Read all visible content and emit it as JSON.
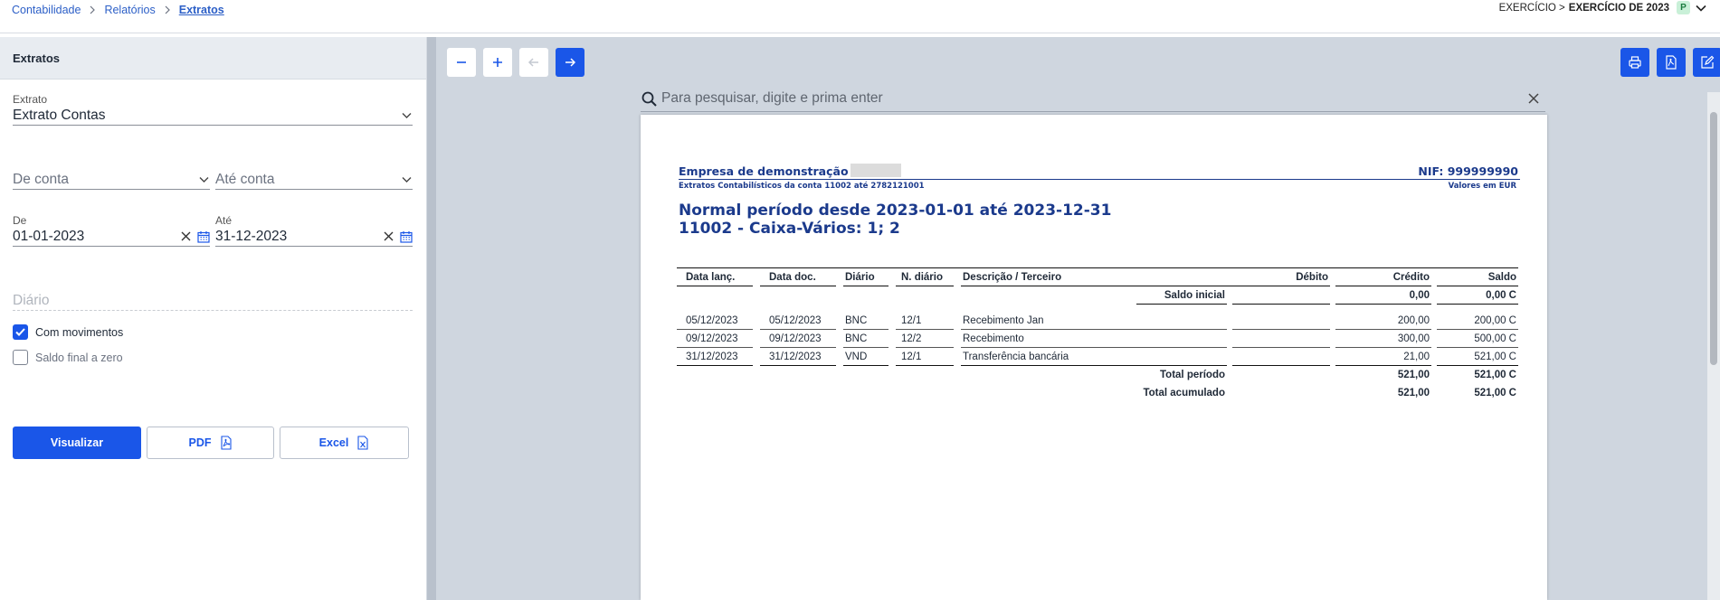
{
  "breadcrumb": [
    "Contabilidade",
    "Relatórios",
    "Extratos"
  ],
  "exercise": {
    "prefix": "EXERCÍCIO >",
    "value": "EXERCÍCIO DE 2023",
    "badge": "P"
  },
  "panel": {
    "title": "Extratos",
    "extrato": {
      "label": "Extrato",
      "value": "Extrato Contas"
    },
    "de_conta": {
      "placeholder": "De conta"
    },
    "ate_conta": {
      "placeholder": "Até conta"
    },
    "de": {
      "label": "De",
      "value": "01-01-2023"
    },
    "ate": {
      "label": "Até",
      "value": "31-12-2023"
    },
    "diario": {
      "placeholder": "Diário"
    },
    "com_movimentos": {
      "label": "Com movimentos",
      "checked": true
    },
    "saldo_final": {
      "label": "Saldo final a zero",
      "checked": false
    },
    "buttons": {
      "visualizar": "Visualizar",
      "pdf": "PDF",
      "excel": "Excel"
    }
  },
  "viewer": {
    "search_placeholder": "Para pesquisar, digite e prima enter",
    "colors": {
      "accent": "#1a56e8",
      "report_blue": "#1b3a8c"
    }
  },
  "report": {
    "company": "Empresa de demonstração",
    "nif": "NIF: 999999990",
    "subtitle": "Extratos Contabilísticos da conta 11002 até 2782121001",
    "currency": "Valores em EUR",
    "period_title": "Normal período desde 2023-01-01 até 2023-12-31",
    "account_title": "11002 - Caixa-Vários: 1; 2",
    "columns": {
      "data_lanc": "Data lanç.",
      "data_doc": "Data doc.",
      "diario": "Diário",
      "n_diario": "N. diário",
      "descricao": "Descrição / Terceiro",
      "debito": "Débito",
      "credito": "Crédito",
      "saldo": "Saldo"
    },
    "saldo_inicial": {
      "label": "Saldo inicial",
      "credito": "0,00",
      "saldo": "0,00 C"
    },
    "rows": [
      {
        "data_lanc": "05/12/2023",
        "data_doc": "05/12/2023",
        "diario": "BNC",
        "n_diario": "12/1",
        "descricao": "Recebimento Jan",
        "debito": "",
        "credito": "200,00",
        "saldo": "200,00 C"
      },
      {
        "data_lanc": "09/12/2023",
        "data_doc": "09/12/2023",
        "diario": "BNC",
        "n_diario": "12/2",
        "descricao": "Recebimento",
        "debito": "",
        "credito": "300,00",
        "saldo": "500,00 C"
      },
      {
        "data_lanc": "31/12/2023",
        "data_doc": "31/12/2023",
        "diario": "VND",
        "n_diario": "12/1",
        "descricao": "Transferência bancária",
        "debito": "",
        "credito": "21,00",
        "saldo": "521,00 C"
      }
    ],
    "total_periodo": {
      "label": "Total período",
      "credito": "521,00",
      "saldo": "521,00 C"
    },
    "total_acumulado": {
      "label": "Total acumulado",
      "credito": "521,00",
      "saldo": "521,00 C"
    }
  }
}
